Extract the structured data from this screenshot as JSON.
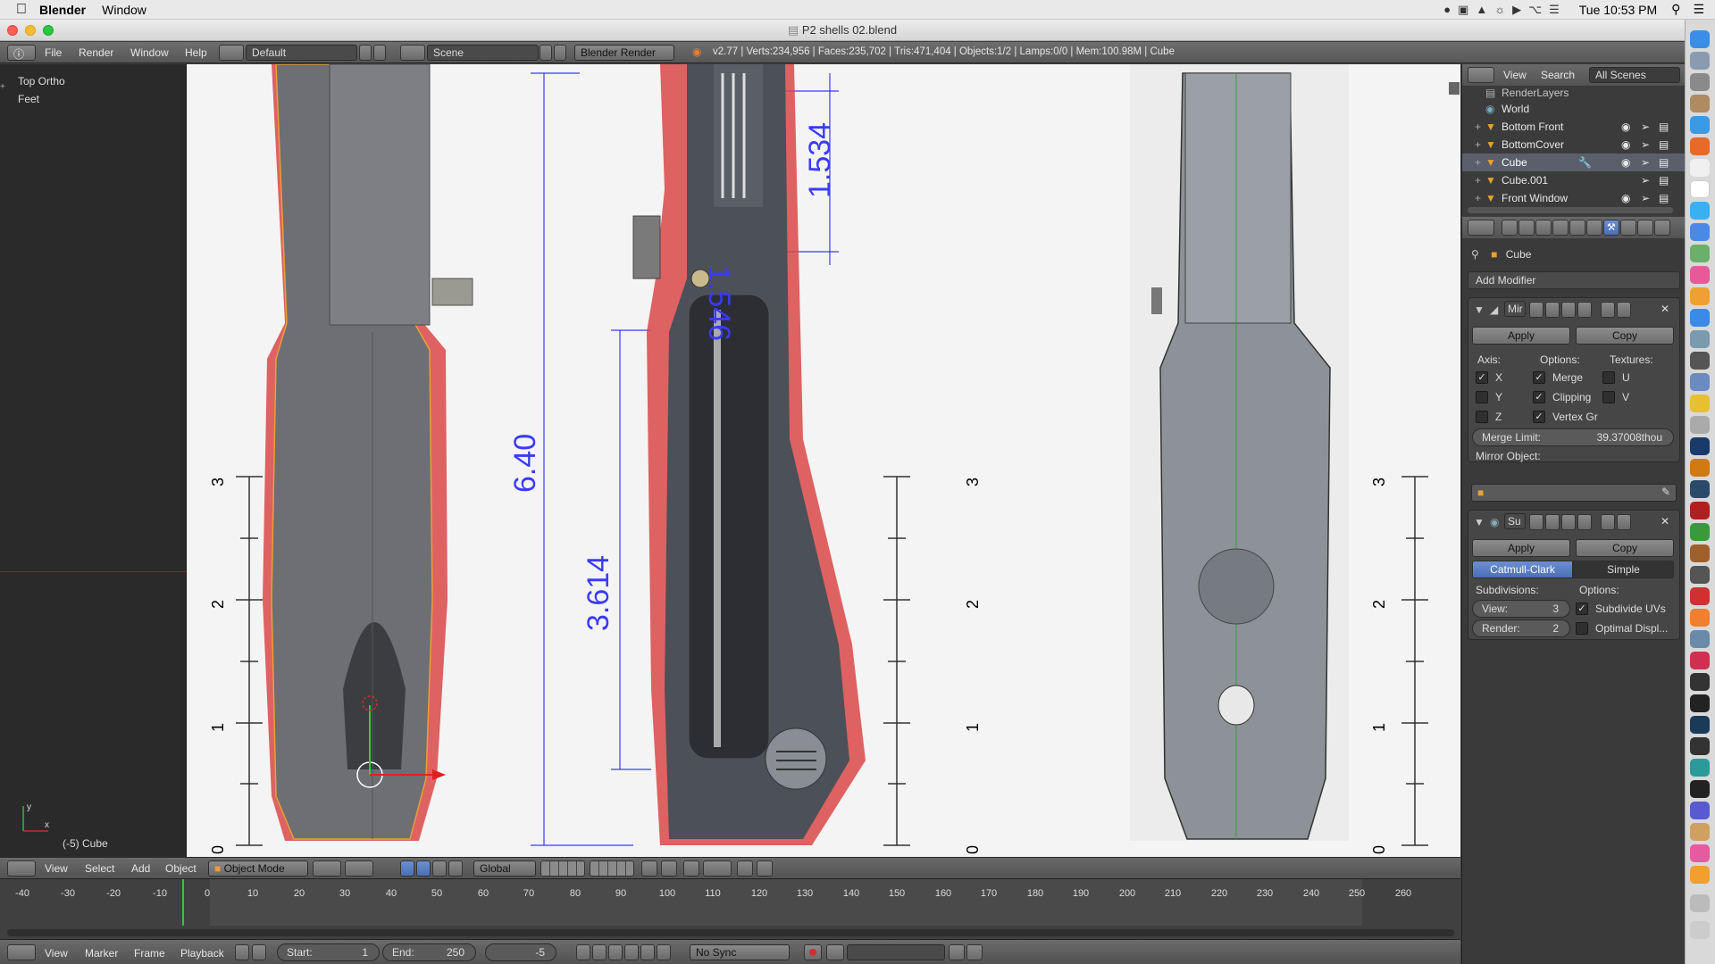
{
  "macos": {
    "app_name": "Blender",
    "menu_window": "Window",
    "clock": "Tue 10:53 PM"
  },
  "window": {
    "title": "P2 shells 02.blend"
  },
  "info_header": {
    "menus": [
      "File",
      "Render",
      "Window",
      "Help"
    ],
    "screen_layout": "Default",
    "scene": "Scene",
    "render_engine": "Blender Render",
    "stats": "v2.77 | Verts:234,956 | Faces:235,702 | Tris:471,404 | Objects:1/2 | Lamps:0/0 | Mem:100.98M | Cube"
  },
  "viewport": {
    "view_name": "Top Ortho",
    "units": "Feet",
    "object_label": "(-5) Cube",
    "dim_labels": [
      "6.40",
      "3.614",
      "1.546",
      "1.534"
    ],
    "ruler_labels": [
      "0",
      "1",
      "2",
      "3"
    ]
  },
  "viewport_header": {
    "menus": [
      "View",
      "Select",
      "Add",
      "Object"
    ],
    "mode": "Object Mode",
    "orientation": "Global"
  },
  "timeline": {
    "ticks": [
      "-40",
      "-30",
      "-20",
      "-10",
      "0",
      "10",
      "20",
      "30",
      "40",
      "50",
      "60",
      "70",
      "80",
      "90",
      "100",
      "110",
      "120",
      "130",
      "140",
      "150",
      "160",
      "170",
      "180",
      "190",
      "200",
      "210",
      "220",
      "230",
      "240",
      "250",
      "260"
    ],
    "current_frame_marker": -5,
    "menus": [
      "View",
      "Marker",
      "Frame",
      "Playback"
    ],
    "start_label": "Start:",
    "start_value": "1",
    "end_label": "End:",
    "end_value": "250",
    "current_value": "-5",
    "sync": "No Sync"
  },
  "outliner": {
    "menus": [
      "View",
      "Search"
    ],
    "filter": "All Scenes",
    "items": [
      {
        "name": "RenderLayers",
        "icon": "render-layers-icon"
      },
      {
        "name": "World",
        "icon": "world-icon"
      },
      {
        "name": "Bottom Front",
        "icon": "mesh-object-icon"
      },
      {
        "name": "BottomCover",
        "icon": "mesh-object-icon"
      },
      {
        "name": "Cube",
        "icon": "mesh-object-icon"
      },
      {
        "name": "Cube.001",
        "icon": "mesh-object-icon"
      },
      {
        "name": "Front Window",
        "icon": "mesh-object-icon"
      }
    ]
  },
  "properties": {
    "context_object": "Cube",
    "add_modifier": "Add Modifier",
    "mirror": {
      "name": "Mir",
      "apply": "Apply",
      "copy": "Copy",
      "axis_label": "Axis:",
      "options_label": "Options:",
      "textures_label": "Textures:",
      "axis_x": "X",
      "axis_y": "Y",
      "axis_z": "Z",
      "merge": "Merge",
      "clipping": "Clipping",
      "vertex_groups": "Vertex Gr",
      "tex_u": "U",
      "tex_v": "V",
      "merge_limit_label": "Merge Limit:",
      "merge_limit_value": "39.37008thou",
      "mirror_object_label": "Mirror Object:"
    },
    "subsurf": {
      "name": "Su",
      "apply": "Apply",
      "copy": "Copy",
      "catmull": "Catmull-Clark",
      "simple": "Simple",
      "subdivisions_label": "Subdivisions:",
      "options_label": "Options:",
      "view_label": "View:",
      "view_value": "3",
      "render_label": "Render:",
      "render_value": "2",
      "subdivide_uvs": "Subdivide UVs",
      "optimal_display": "Optimal Displ..."
    }
  },
  "colors": {
    "accent_blue": "#5680c2",
    "selection_orange": "#e8a030",
    "dimension_blue": "#3a3aff"
  }
}
